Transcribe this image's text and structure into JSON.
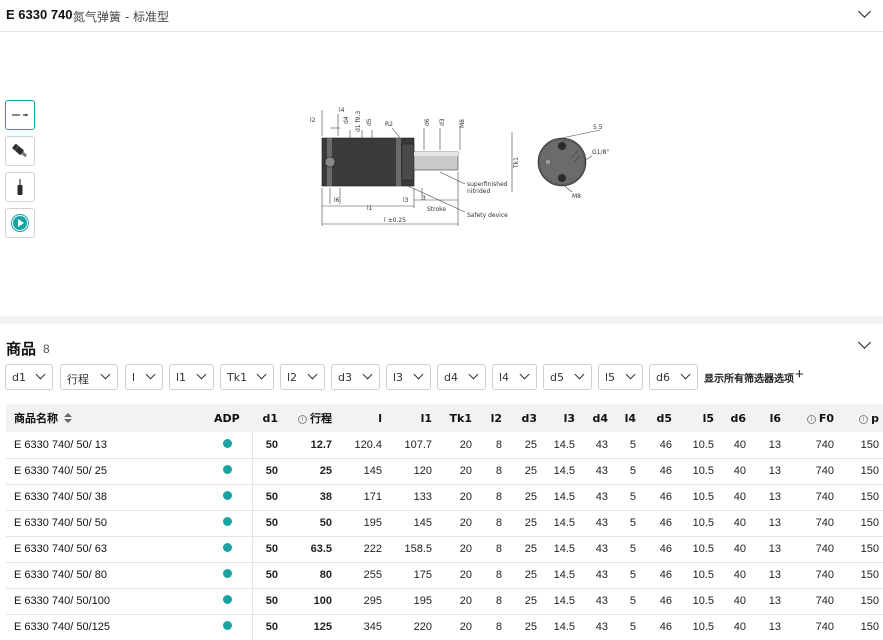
{
  "header": {
    "code": "E 6330 740",
    "subtitle": "氮气弹簧 - 标准型"
  },
  "drawing": {
    "labels": [
      "l4",
      "l2",
      "d4",
      "d1 f9.3",
      "d5",
      "R2",
      "d6",
      "d3",
      "M8",
      "5.5",
      "G1/8\"",
      "Tk1",
      "superfinished",
      "nitrided",
      "l6",
      "l3",
      "3",
      "Stroke",
      "l1",
      "Safety device",
      "l ±0.25",
      "M8"
    ]
  },
  "products": {
    "title": "商品",
    "count": "8",
    "filters": [
      "d1",
      "行程",
      "l",
      "l1",
      "Tk1",
      "l2",
      "d3",
      "l3",
      "d4",
      "l4",
      "d5",
      "l5",
      "d6"
    ],
    "show_all": "显示所有筛选器选项",
    "plus": "+",
    "columns": [
      "商品名称",
      "ADP",
      "d1",
      "行程",
      "l",
      "l1",
      "Tk1",
      "l2",
      "d3",
      "l3",
      "d4",
      "l4",
      "d5",
      "l5",
      "d6",
      "l6",
      "F0",
      "p"
    ],
    "rows": [
      [
        "E 6330 740/ 50/ 13",
        "50",
        "12.7",
        "120.4",
        "107.7",
        "20",
        "8",
        "25",
        "14.5",
        "43",
        "5",
        "46",
        "10.5",
        "40",
        "13",
        "740",
        "150"
      ],
      [
        "E 6330 740/ 50/ 25",
        "50",
        "25",
        "145",
        "120",
        "20",
        "8",
        "25",
        "14.5",
        "43",
        "5",
        "46",
        "10.5",
        "40",
        "13",
        "740",
        "150"
      ],
      [
        "E 6330 740/ 50/ 38",
        "50",
        "38",
        "171",
        "133",
        "20",
        "8",
        "25",
        "14.5",
        "43",
        "5",
        "46",
        "10.5",
        "40",
        "13",
        "740",
        "150"
      ],
      [
        "E 6330 740/ 50/ 50",
        "50",
        "50",
        "195",
        "145",
        "20",
        "8",
        "25",
        "14.5",
        "43",
        "5",
        "46",
        "10.5",
        "40",
        "13",
        "740",
        "150"
      ],
      [
        "E 6330 740/ 50/ 63",
        "50",
        "63.5",
        "222",
        "158.5",
        "20",
        "8",
        "25",
        "14.5",
        "43",
        "5",
        "46",
        "10.5",
        "40",
        "13",
        "740",
        "150"
      ],
      [
        "E 6330 740/ 50/ 80",
        "50",
        "80",
        "255",
        "175",
        "20",
        "8",
        "25",
        "14.5",
        "43",
        "5",
        "46",
        "10.5",
        "40",
        "13",
        "740",
        "150"
      ],
      [
        "E 6330 740/ 50/100",
        "50",
        "100",
        "295",
        "195",
        "20",
        "8",
        "25",
        "14.5",
        "43",
        "5",
        "46",
        "10.5",
        "40",
        "13",
        "740",
        "150"
      ],
      [
        "E 6330 740/ 50/125",
        "50",
        "125",
        "345",
        "220",
        "20",
        "8",
        "25",
        "14.5",
        "43",
        "5",
        "46",
        "10.5",
        "40",
        "13",
        "740",
        "150"
      ]
    ]
  },
  "colors": {
    "accent": "#1aa3a3",
    "divider": "#f2f2f2",
    "header_bg": "#f2f2f2"
  },
  "icons": [
    "chevron-down-icon",
    "drawing-thumb-icon",
    "spring-side-icon",
    "spring-upright-icon",
    "play-video-icon",
    "sort-icon",
    "info-icon",
    "plus-icon"
  ]
}
